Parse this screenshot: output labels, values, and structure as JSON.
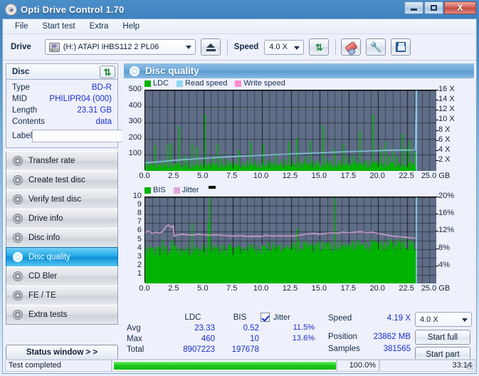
{
  "window": {
    "title": "Opti Drive Control 1.70",
    "title_icon": "disc-icon",
    "minimize": "–",
    "maximize": "□",
    "close": "X"
  },
  "menu": {
    "items": [
      "File",
      "Start test",
      "Extra",
      "Help"
    ]
  },
  "toolbar": {
    "drive_label": "Drive",
    "drive_value": "(H:)  ATAPI iHBS112  2 PL06",
    "eject_icon": "eject-icon",
    "speed_label": "Speed",
    "speed_value": "4.0 X",
    "refresh_icon": "refresh-icon",
    "eraser_icon": "eraser-icon",
    "tools_icon": "wrench-icon",
    "save_icon": "floppy-disk-icon"
  },
  "disc": {
    "header": "Disc",
    "refresh_icon": "refresh-icon",
    "rows": [
      {
        "key": "Type",
        "value": "BD-R"
      },
      {
        "key": "MID",
        "value": "PHILIPR04 (000)"
      },
      {
        "key": "Length",
        "value": "23.31 GB"
      },
      {
        "key": "Contents",
        "value": "data"
      }
    ],
    "label_key": "Label",
    "label_value": "",
    "label_placeholder": "",
    "disc_icon": "cd-icon"
  },
  "nav": {
    "items": [
      {
        "label": "Transfer rate",
        "icon": "disc-icon",
        "active": false
      },
      {
        "label": "Create test disc",
        "icon": "disc-icon",
        "active": false
      },
      {
        "label": "Verify test disc",
        "icon": "disc-icon",
        "active": false
      },
      {
        "label": "Drive info",
        "icon": "disc-icon",
        "active": false
      },
      {
        "label": "Disc info",
        "icon": "disc-icon",
        "active": false
      },
      {
        "label": "Disc quality",
        "icon": "disc-icon",
        "active": true
      },
      {
        "label": "CD Bler",
        "icon": "disc-icon",
        "active": false
      },
      {
        "label": "FE / TE",
        "icon": "disc-icon",
        "active": false
      },
      {
        "label": "Extra tests",
        "icon": "disc-icon",
        "active": false
      }
    ],
    "status_window": "Status window > >"
  },
  "panel": {
    "title": "Disc quality",
    "icon": "disc-icon"
  },
  "colors": {
    "ldc": "#00b300",
    "bis": "#00b300",
    "read_speed": "#8fd8f5",
    "write_speed": "#ff8fd0",
    "jitter": "#e0a8d8",
    "plot_bg": "#5f6d87",
    "accent": "#5b9bd1",
    "value_text": "#1a2fd0",
    "progress": "#17c717"
  },
  "chart_data": [
    {
      "type": "bar",
      "title": "LDC / Read speed",
      "legend": [
        {
          "label": "LDC",
          "color": "#00b300"
        },
        {
          "label": "Read speed",
          "color": "#8fd8f5"
        },
        {
          "label": "Write speed",
          "color": "#ff8fd0"
        }
      ],
      "legend_position": "top-left",
      "xlabel": "GB",
      "ylabel": "LDC",
      "y2label": "Speed",
      "xlim": [
        0.0,
        25.0
      ],
      "ylim": [
        0,
        500
      ],
      "y2lim": [
        0,
        16
      ],
      "xticks": [
        "0.0",
        "2.5",
        "5.0",
        "7.5",
        "10.0",
        "12.5",
        "15.0",
        "17.5",
        "20.0",
        "22.5",
        "25.0 GB"
      ],
      "yticks": [
        "100",
        "200",
        "300",
        "400",
        "500"
      ],
      "y2ticks": [
        "2 X",
        "4 X",
        "6 X",
        "8 X",
        "10 X",
        "12 X",
        "14 X",
        "16 X"
      ],
      "grid": true,
      "data_end_x": 23.3,
      "series": [
        {
          "name": "LDC",
          "color": "#00b300",
          "type": "bar",
          "x": [
            0.1,
            0.4,
            0.8,
            1.2,
            1.5,
            1.9,
            2.2,
            2.6,
            2.9,
            3.3,
            3.6,
            4.0,
            4.4,
            4.7,
            5.1,
            5.4,
            5.8,
            6.2,
            6.5,
            6.9,
            7.2,
            7.6,
            8.0,
            8.3,
            8.7,
            9.0,
            9.4,
            9.8,
            10.1,
            10.5,
            10.8,
            11.2,
            11.6,
            11.9,
            12.3,
            12.6,
            13.0,
            13.4,
            13.7,
            14.1,
            14.4,
            14.8,
            15.2,
            15.5,
            15.9,
            16.2,
            16.6,
            17.0,
            17.3,
            17.7,
            18.0,
            18.4,
            18.8,
            19.1,
            19.5,
            19.8,
            20.2,
            20.6,
            20.9,
            21.3,
            21.6,
            22.0,
            22.4,
            22.7,
            23.1
          ],
          "values": [
            62,
            55,
            160,
            48,
            70,
            162,
            175,
            52,
            280,
            98,
            66,
            170,
            150,
            60,
            352,
            58,
            86,
            170,
            90,
            74,
            64,
            68,
            130,
            56,
            64,
            180,
            72,
            60,
            168,
            70,
            58,
            95,
            62,
            76,
            180,
            68,
            205,
            60,
            88,
            188,
            64,
            70,
            282,
            76,
            64,
            140,
            72,
            170,
            86,
            98,
            78,
            248,
            64,
            72,
            350,
            66,
            142,
            180,
            96,
            124,
            88,
            232,
            148,
            190,
            120
          ],
          "baseline_avg": 23.33,
          "max": 460
        },
        {
          "name": "Read speed",
          "color": "#8fd8f5",
          "type": "line",
          "axis": "y2",
          "x": [
            0.0,
            1.5,
            3.0,
            5.0,
            7.0,
            9.0,
            11.0,
            13.0,
            15.0,
            17.0,
            19.0,
            21.0,
            22.5,
            23.2,
            23.3
          ],
          "values": [
            1.6,
            1.9,
            2.2,
            2.5,
            2.8,
            3.0,
            3.2,
            3.4,
            3.6,
            3.8,
            3.95,
            4.1,
            4.15,
            4.19,
            16.0
          ]
        },
        {
          "name": "Write speed",
          "color": "#ff8fd0",
          "type": "line",
          "axis": "y2",
          "x": [],
          "values": []
        }
      ]
    },
    {
      "type": "bar",
      "title": "BIS / Jitter",
      "legend": [
        {
          "label": "BIS",
          "color": "#00b300"
        },
        {
          "label": "Jitter",
          "color": "#e0a8d8"
        }
      ],
      "legend_position": "top-left",
      "xlabel": "GB",
      "ylabel": "BIS",
      "y2label": "Jitter",
      "xlim": [
        0.0,
        25.0
      ],
      "ylim": [
        0,
        10
      ],
      "y2lim": [
        0,
        20
      ],
      "xticks": [
        "0.0",
        "2.5",
        "5.0",
        "7.5",
        "10.0",
        "12.5",
        "15.0",
        "17.5",
        "20.0",
        "22.5",
        "25.0 GB"
      ],
      "yticks": [
        "1",
        "2",
        "3",
        "4",
        "5",
        "6",
        "7",
        "8",
        "9",
        "10"
      ],
      "y2ticks": [
        "4%",
        "8%",
        "12%",
        "16%",
        "20%"
      ],
      "grid": true,
      "data_end_x": 23.3,
      "series": [
        {
          "name": "BIS",
          "color": "#00b300",
          "type": "bar",
          "fill_level": 3.0,
          "x": [
            0.2,
            0.6,
            1.0,
            1.4,
            1.8,
            2.2,
            2.4,
            2.8,
            3.2,
            3.6,
            4.0,
            4.2,
            4.6,
            5.0,
            5.4,
            5.5,
            5.8,
            6.2,
            6.6,
            7.0,
            7.4,
            7.8,
            8.2,
            8.6,
            9.0,
            9.4,
            9.8,
            10.2,
            10.6,
            11.0,
            11.4,
            11.8,
            12.2,
            12.6,
            13.0,
            13.4,
            13.8,
            14.2,
            14.6,
            15.0,
            15.4,
            15.8,
            16.2,
            16.6,
            17.0,
            17.4,
            17.8,
            18.2,
            18.6,
            19.0,
            19.4,
            19.8,
            20.2,
            20.6,
            21.0,
            21.4,
            21.8,
            22.2,
            22.6,
            23.0
          ],
          "values": [
            4.1,
            3.9,
            4.2,
            5.1,
            4.0,
            4.8,
            5.1,
            3.6,
            3.8,
            4.1,
            7.0,
            3.7,
            3.9,
            3.6,
            7.1,
            10.0,
            3.8,
            4.0,
            3.7,
            3.9,
            4.1,
            3.6,
            3.9,
            4.2,
            3.8,
            3.7,
            4.0,
            4.3,
            3.9,
            4.1,
            3.8,
            4.0,
            4.2,
            3.9,
            6.4,
            4.0,
            3.8,
            4.1,
            4.4,
            3.9,
            4.0,
            4.2,
            9.9,
            4.1,
            3.9,
            4.3,
            4.5,
            4.2,
            4.0,
            4.4,
            4.6,
            4.3,
            4.1,
            4.8,
            5.0,
            4.6,
            5.2,
            5.4,
            5.0,
            4.8
          ],
          "avg": 0.52,
          "max": 10
        },
        {
          "name": "Jitter",
          "color": "#e0a8d8",
          "type": "line",
          "axis": "y2",
          "x": [
            0.0,
            0.3,
            0.6,
            0.9,
            1.2,
            1.5,
            1.8,
            2.0,
            2.2,
            2.4,
            2.5,
            2.8,
            3.2,
            3.6,
            4.0,
            4.5,
            5.0,
            5.5,
            6.0,
            6.5,
            7.0,
            7.5,
            8.0,
            8.5,
            9.0,
            9.5,
            10.0,
            10.3,
            10.6,
            11.0,
            11.4,
            11.8,
            12.2,
            12.6,
            13.0,
            13.5,
            14.0,
            14.5,
            15.0,
            15.5,
            16.0,
            16.5,
            17.0,
            17.5,
            18.0,
            18.5,
            19.0,
            19.5,
            20.0,
            20.4,
            20.8,
            21.2,
            21.6,
            22.0,
            22.4,
            22.8,
            23.2
          ],
          "values": [
            11.8,
            12.2,
            11.6,
            11.9,
            11.7,
            12.0,
            13.2,
            13.6,
            13.0,
            13.4,
            11.0,
            11.3,
            11.4,
            11.3,
            11.2,
            11.4,
            11.3,
            11.2,
            11.3,
            11.2,
            11.1,
            11.0,
            11.1,
            11.0,
            10.9,
            11.0,
            10.9,
            11.2,
            11.1,
            11.0,
            11.1,
            11.0,
            11.1,
            11.0,
            11.1,
            11.3,
            11.5,
            11.6,
            11.4,
            11.6,
            11.8,
            11.7,
            11.9,
            11.8,
            11.9,
            12.0,
            11.8,
            11.9,
            11.6,
            11.4,
            11.2,
            11.0,
            10.9,
            10.8,
            10.7,
            10.6,
            10.5
          ],
          "avg": 11.5,
          "max": 13.6
        }
      ]
    }
  ],
  "stats": {
    "columns": [
      "",
      "LDC",
      "BIS"
    ],
    "rows": [
      {
        "label": "Avg",
        "ldc": "23.33",
        "bis": "0.52",
        "jitter": "11.5%"
      },
      {
        "label": "Max",
        "ldc": "460",
        "bis": "10",
        "jitter": "13.6%"
      },
      {
        "label": "Total",
        "ldc": "8907223",
        "bis": "197678",
        "jitter": ""
      }
    ],
    "jitter_label": "Jitter",
    "jitter_checked": true
  },
  "readout": {
    "speed_label": "Speed",
    "speed_value": "4.19 X",
    "speed_select": "4.0 X",
    "position_label": "Position",
    "position_value": "23862 MB",
    "samples_label": "Samples",
    "samples_value": "381565",
    "start_full": "Start full",
    "start_part": "Start part"
  },
  "statusbar": {
    "message": "Test completed",
    "percent": "100.0%",
    "percent_value": 100,
    "elapsed": "33:14"
  }
}
